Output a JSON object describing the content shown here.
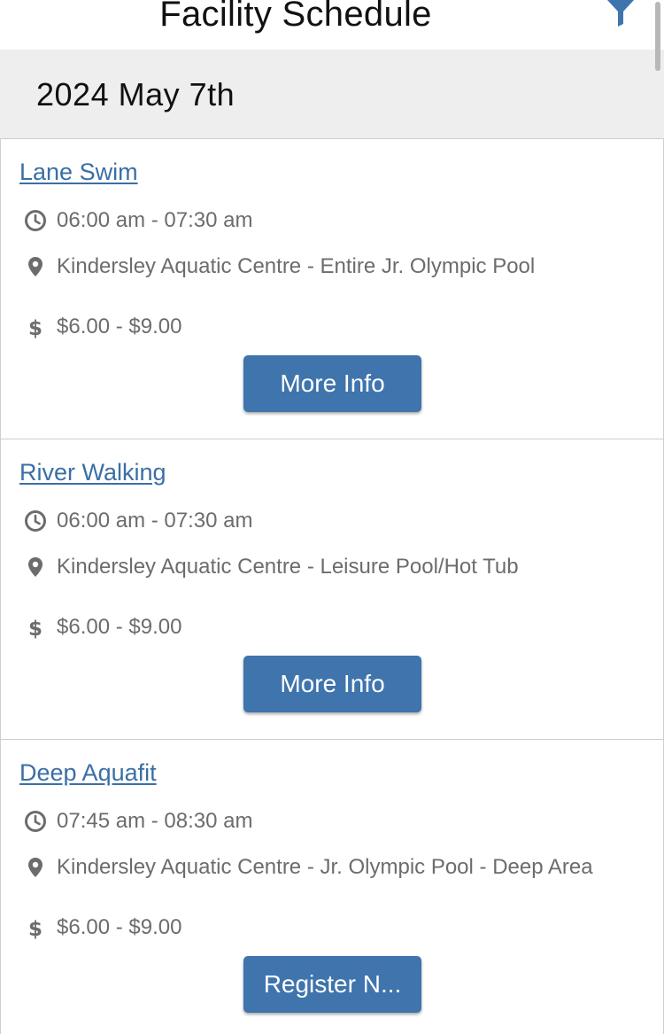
{
  "header": {
    "title": "Facility Schedule",
    "filter_icon": "filter-icon",
    "accent": "#3f74ad"
  },
  "date_bar": {
    "date": "2024 May 7th"
  },
  "schedule": [
    {
      "title": "Lane Swim",
      "time": "06:00 am - 07:30 am",
      "location": "Kindersley Aquatic Centre - Entire Jr. Olympic Pool",
      "price": "$6.00 - $9.00",
      "button": "More Info"
    },
    {
      "title": "River Walking",
      "time": "06:00 am - 07:30 am",
      "location": "Kindersley Aquatic Centre - Leisure Pool/Hot Tub",
      "price": "$6.00 - $9.00",
      "button": "More Info"
    },
    {
      "title": "Deep Aquafit",
      "time": "07:45 am - 08:30 am",
      "location": "Kindersley Aquatic Centre - Jr. Olympic Pool - Deep Area",
      "price": "$6.00 - $9.00",
      "button": "Register N..."
    }
  ],
  "icons": {
    "time": "clock-icon",
    "location": "map-pin-icon",
    "price": "dollar-icon"
  },
  "colors": {
    "link": "#3a6fa5",
    "button": "#3f74ad",
    "date_bar_bg": "#eeeeee",
    "meta_text": "#6c6c6c"
  }
}
